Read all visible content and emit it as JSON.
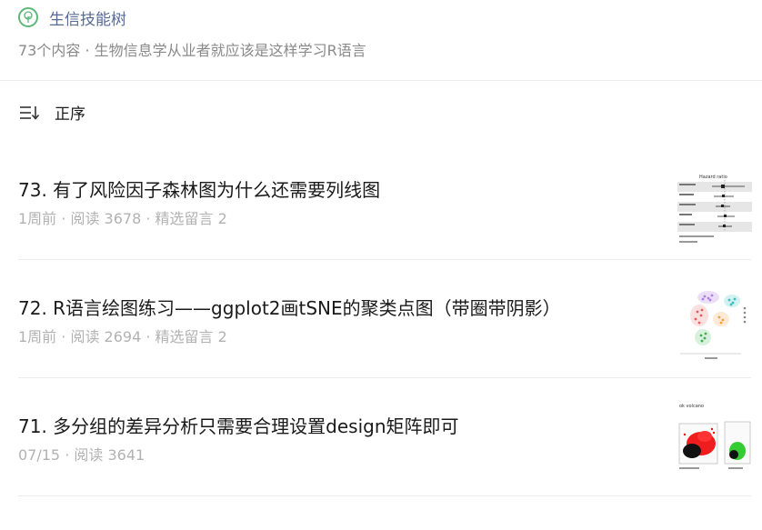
{
  "account": {
    "name": "生信技能树",
    "subtitle": "73个内容 · 生物信息学从业者就应该是这样学习R语言",
    "brand_color": "#5fb878"
  },
  "sort": {
    "icon": "sort-order-icon",
    "label": "正序"
  },
  "articles": [
    {
      "title": "73. 有了风险因子森林图为什么还需要列线图",
      "meta": [
        "1周前",
        "阅读 3678",
        "精选留言 2"
      ],
      "thumb": {
        "icon": "forest-plot-thumbnail",
        "title": "Hazard ratio"
      }
    },
    {
      "title": "72. R语言绘图练习——ggplot2画tSNE的聚类点图（带圈带阴影）",
      "meta": [
        "1周前",
        "阅读 2694",
        "精选留言 2"
      ],
      "thumb": {
        "icon": "tsne-scatter-thumbnail"
      }
    },
    {
      "title": "71. 多分组的差异分析只需要合理设置design矩阵即可",
      "meta": [
        "07/15",
        "阅读 3641"
      ],
      "thumb": {
        "icon": "volcano-plot-thumbnail",
        "title": "ok volcano"
      }
    }
  ]
}
